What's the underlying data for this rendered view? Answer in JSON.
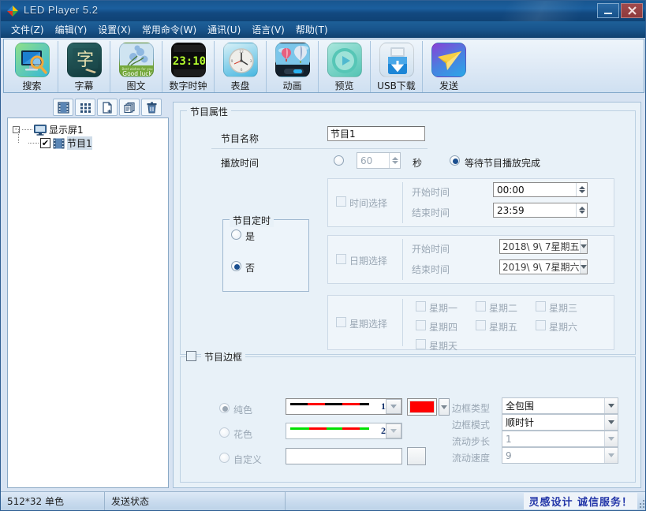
{
  "window": {
    "title": "LED Player 5.2",
    "logo_icon": "app-diamond-logo",
    "minimize_label": "_",
    "close_label": "×"
  },
  "menubar": {
    "items": [
      {
        "label": "文件(Z)",
        "name": "menu-file"
      },
      {
        "label": "编辑(Y)",
        "name": "menu-edit"
      },
      {
        "label": "设置(X)",
        "name": "menu-settings"
      },
      {
        "label": "常用命令(W)",
        "name": "menu-commands"
      },
      {
        "label": "通讯(U)",
        "name": "menu-communication"
      },
      {
        "label": "语言(V)",
        "name": "menu-language"
      },
      {
        "label": "帮助(T)",
        "name": "menu-help"
      }
    ]
  },
  "toolbar": {
    "buttons": [
      {
        "label": "搜索",
        "icon": "screen-search-icon"
      },
      {
        "label": "字幕",
        "icon": "subtitle-character-icon"
      },
      {
        "label": "图文",
        "icon": "image-text-flower-icon"
      },
      {
        "label": "数字时钟",
        "icon": "digital-clock-icon"
      },
      {
        "label": "表盘",
        "icon": "analog-clock-icon"
      },
      {
        "label": "动画",
        "icon": "animation-balloon-icon"
      },
      {
        "label": "预览",
        "icon": "preview-play-icon"
      },
      {
        "label": "USB下载",
        "icon": "usb-download-icon"
      },
      {
        "label": "发送",
        "icon": "send-paperplane-icon"
      }
    ],
    "clock_time": "23:10",
    "image_caption": "Good luck"
  },
  "tree_toolbar": {
    "buttons": [
      {
        "name": "add-program-button",
        "icon": "film-strip-icon"
      },
      {
        "name": "grid-view-button",
        "icon": "grid-dots-icon"
      },
      {
        "name": "new-file-button",
        "icon": "new-page-icon"
      },
      {
        "name": "copy-button",
        "icon": "copy-pages-icon"
      },
      {
        "name": "delete-button",
        "icon": "trash-icon"
      }
    ]
  },
  "tree": {
    "root": {
      "label": "显示屏1",
      "icon": "monitor-icon",
      "expander": "-"
    },
    "children": [
      {
        "label": "节目1",
        "icon": "film-strip-icon",
        "checked": true,
        "check_mark": "✔",
        "selected": true
      }
    ]
  },
  "properties": {
    "group_title": "节目属性",
    "program_name_label": "节目名称",
    "program_name_value": "节目1",
    "play_time_label": "播放时间",
    "play_time_radio_selected": false,
    "play_time_value": "60",
    "seconds_unit": "秒",
    "wait_finish_label": "等待节目播放完成",
    "wait_finish_selected": true,
    "schedule": {
      "group_title": "节目定时",
      "yes_label": "是",
      "no_label": "否",
      "selected": "否"
    },
    "time_select": {
      "checkbox_label": "时间选择",
      "checked": false,
      "start_label": "开始时间",
      "start_value": "00:00",
      "end_label": "结束时间",
      "end_value": "23:59"
    },
    "date_select": {
      "checkbox_label": "日期选择",
      "checked": false,
      "start_label": "开始时间",
      "start_value": "2018\\ 9\\ 7星期五",
      "end_label": "结束时间",
      "end_value": "2019\\ 9\\ 7星期六"
    },
    "week_select": {
      "checkbox_label": "星期选择",
      "checked": false,
      "days": [
        {
          "label": "星期一",
          "checked": false
        },
        {
          "label": "星期二",
          "checked": false
        },
        {
          "label": "星期三",
          "checked": false
        },
        {
          "label": "星期四",
          "checked": false
        },
        {
          "label": "星期五",
          "checked": false
        },
        {
          "label": "星期六",
          "checked": false
        },
        {
          "label": "星期天",
          "checked": false
        }
      ]
    },
    "border": {
      "group_title": "节目边框",
      "enabled": false,
      "solid_color_label": "纯色",
      "solid_selected": true,
      "pattern_color_label": "花色",
      "custom_label": "自定义",
      "style1_number": "1",
      "style2_number": "2",
      "custom_value": "",
      "color_swatch": "#ff0000",
      "border_type_label": "边框类型",
      "border_type_value": "全包围",
      "border_mode_label": "边框模式",
      "border_mode_value": "顺时针",
      "flow_step_label": "流动步长",
      "flow_step_value": "1",
      "flow_speed_label": "流动速度",
      "flow_speed_value": "9"
    }
  },
  "statusbar": {
    "resolution": "512*32 单色",
    "send_status": "发送状态",
    "slogan": "灵感设计   诚信服务！"
  }
}
